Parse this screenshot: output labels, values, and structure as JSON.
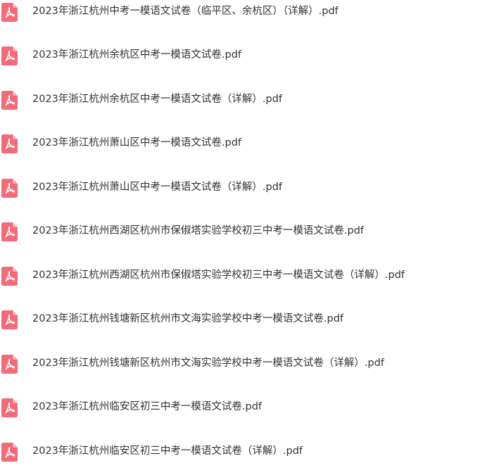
{
  "colors": {
    "pdf_icon": "#F56A77",
    "text": "#333333",
    "background": "#FFFFFF"
  },
  "icon": "pdf-file-icon",
  "files": [
    {
      "name": "2023年浙江杭州中考一模语文试卷（临平区、余杭区）（详解）.pdf"
    },
    {
      "name": "2023年浙江杭州余杭区中考一模语文试卷.pdf"
    },
    {
      "name": "2023年浙江杭州余杭区中考一模语文试卷（详解）.pdf"
    },
    {
      "name": "2023年浙江杭州萧山区中考一模语文试卷.pdf"
    },
    {
      "name": "2023年浙江杭州萧山区中考一模语文试卷（详解）.pdf"
    },
    {
      "name": "2023年浙江杭州西湖区杭州市保俶塔实验学校初三中考一模语文试卷.pdf"
    },
    {
      "name": "2023年浙江杭州西湖区杭州市保俶塔实验学校初三中考一模语文试卷（详解）.pdf"
    },
    {
      "name": "2023年浙江杭州钱塘新区杭州市文海实验学校中考一模语文试卷.pdf"
    },
    {
      "name": "2023年浙江杭州钱塘新区杭州市文海实验学校中考一模语文试卷（详解）.pdf"
    },
    {
      "name": "2023年浙江杭州临安区初三中考一模语文试卷.pdf"
    },
    {
      "name": "2023年浙江杭州临安区初三中考一模语文试卷（详解）.pdf"
    }
  ]
}
